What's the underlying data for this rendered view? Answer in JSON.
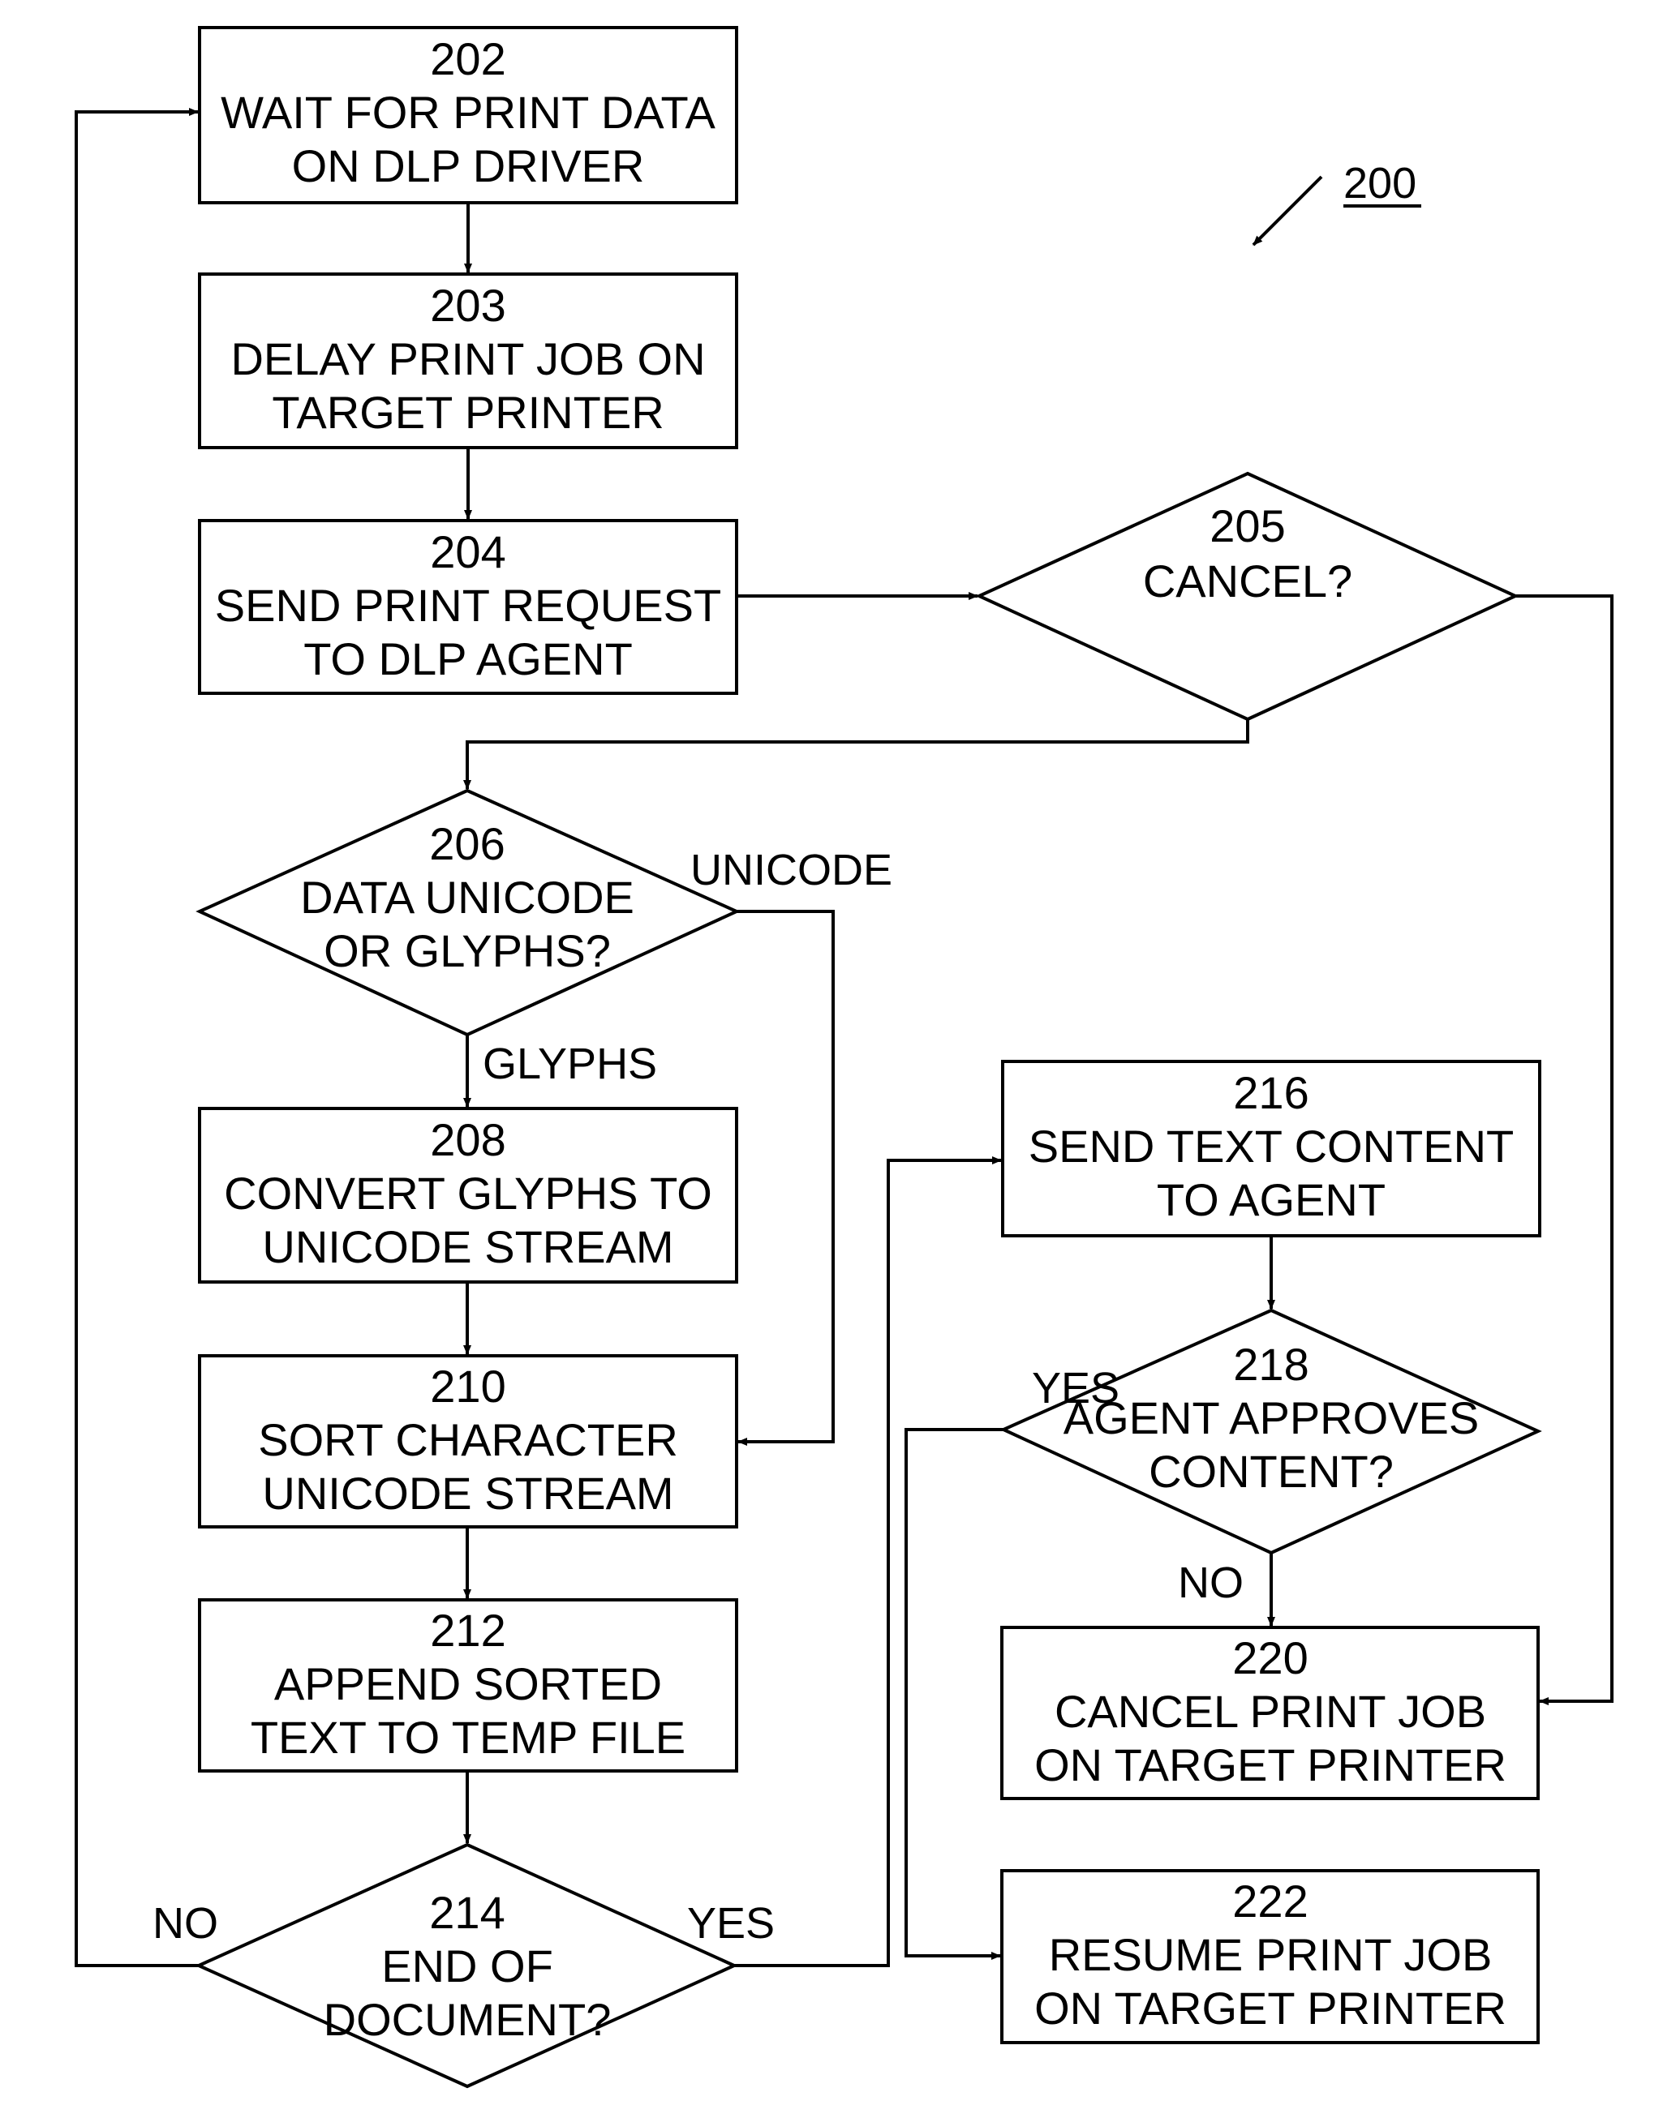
{
  "figure": {
    "reference": "200",
    "nodes": {
      "n202": {
        "id": "202",
        "type": "process",
        "lines": [
          "WAIT FOR PRINT DATA",
          "ON DLP DRIVER"
        ]
      },
      "n203": {
        "id": "203",
        "type": "process",
        "lines": [
          "DELAY PRINT JOB ON",
          "TARGET PRINTER"
        ]
      },
      "n204": {
        "id": "204",
        "type": "process",
        "lines": [
          "SEND PRINT REQUEST",
          "TO DLP AGENT"
        ]
      },
      "n205": {
        "id": "205",
        "type": "decision",
        "lines": [
          "CANCEL?"
        ]
      },
      "n206": {
        "id": "206",
        "type": "decision",
        "lines": [
          "DATA UNICODE",
          "OR GLYPHS?"
        ]
      },
      "n208": {
        "id": "208",
        "type": "process",
        "lines": [
          "CONVERT GLYPHS TO",
          "UNICODE STREAM"
        ]
      },
      "n210": {
        "id": "210",
        "type": "process",
        "lines": [
          "SORT CHARACTER",
          "UNICODE STREAM"
        ]
      },
      "n212": {
        "id": "212",
        "type": "process",
        "lines": [
          "APPEND SORTED",
          "TEXT TO TEMP FILE"
        ]
      },
      "n214": {
        "id": "214",
        "type": "decision",
        "lines": [
          "END OF",
          "DOCUMENT?"
        ]
      },
      "n216": {
        "id": "216",
        "type": "process",
        "lines": [
          "SEND TEXT CONTENT",
          "TO AGENT"
        ]
      },
      "n218": {
        "id": "218",
        "type": "decision",
        "lines": [
          "AGENT APPROVES",
          "CONTENT?"
        ]
      },
      "n220": {
        "id": "220",
        "type": "process",
        "lines": [
          "CANCEL PRINT JOB",
          "ON TARGET PRINTER"
        ]
      },
      "n222": {
        "id": "222",
        "type": "process",
        "lines": [
          "RESUME PRINT JOB",
          "ON TARGET PRINTER"
        ]
      }
    },
    "edge_labels": {
      "unicode": "UNICODE",
      "glyphs": "GLYPHS",
      "no_214": "NO",
      "yes_214": "YES",
      "yes_218": "YES",
      "no_218": "NO"
    },
    "edges": [
      {
        "from": "202",
        "to": "203"
      },
      {
        "from": "203",
        "to": "204"
      },
      {
        "from": "204",
        "to": "205"
      },
      {
        "from": "205",
        "to": "206"
      },
      {
        "from": "205",
        "to": "220"
      },
      {
        "from": "206",
        "to": "208",
        "label": "GLYPHS"
      },
      {
        "from": "206",
        "to": "210",
        "label": "UNICODE"
      },
      {
        "from": "208",
        "to": "210"
      },
      {
        "from": "210",
        "to": "212"
      },
      {
        "from": "212",
        "to": "214"
      },
      {
        "from": "214",
        "to": "202",
        "label": "NO"
      },
      {
        "from": "214",
        "to": "216",
        "label": "YES"
      },
      {
        "from": "216",
        "to": "218"
      },
      {
        "from": "218",
        "to": "222",
        "label": "YES"
      },
      {
        "from": "218",
        "to": "220",
        "label": "NO"
      }
    ]
  }
}
